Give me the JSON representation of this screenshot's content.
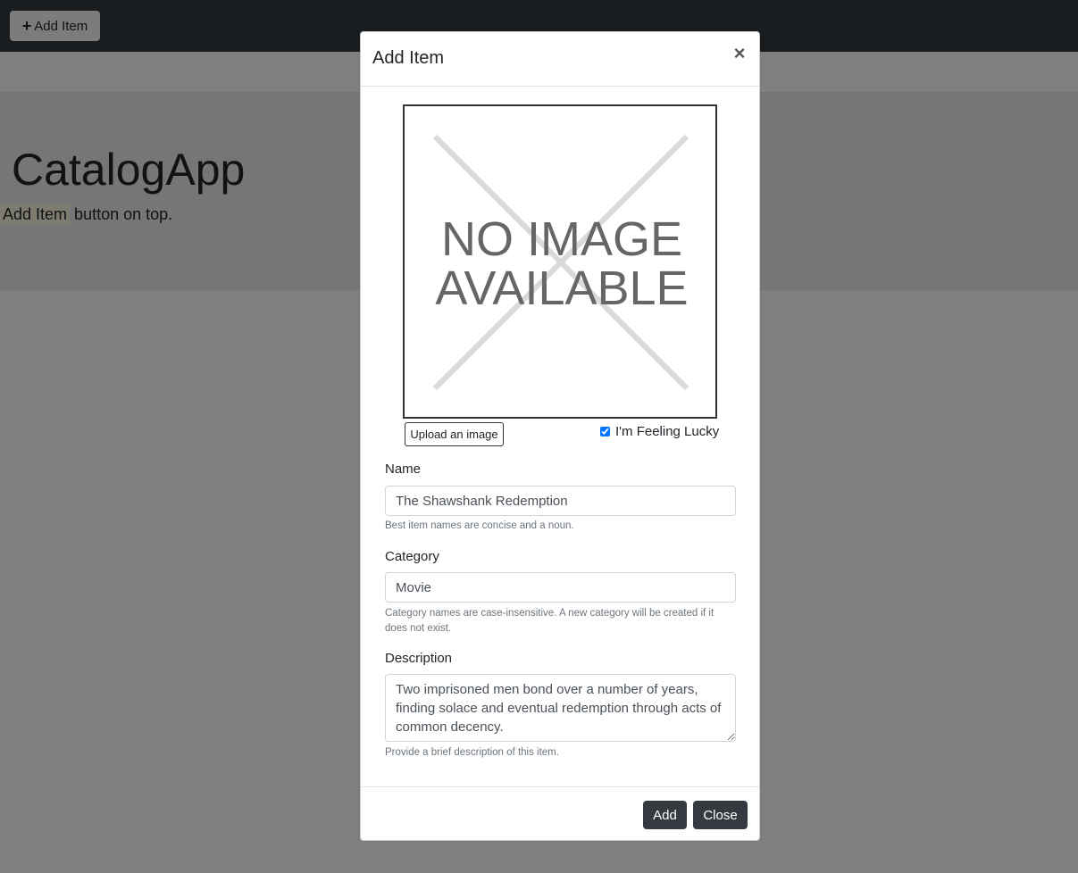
{
  "navbar": {
    "add_item_label": "Add Item"
  },
  "page": {
    "title": "CatalogApp",
    "hint_highlight": "Add Item",
    "hint_rest": " button on top."
  },
  "modal": {
    "title": "Add Item",
    "close_symbol": "×",
    "image_placeholder_line1": "NO IMAGE",
    "image_placeholder_line2": "AVAILABLE",
    "upload_label": "Upload an image",
    "lucky_label": "I'm Feeling Lucky",
    "lucky_checked": true,
    "name": {
      "label": "Name",
      "value": "The Shawshank Redemption",
      "help": "Best item names are concise and a noun."
    },
    "category": {
      "label": "Category",
      "value": "Movie",
      "help": "Category names are case-insensitive. A new category will be created if it does not exist."
    },
    "description": {
      "label": "Description",
      "value": "Two imprisoned men bond over a number of years, finding solace and eventual redemption through acts of common decency.",
      "help": "Provide a brief description of this item."
    },
    "add_label": "Add",
    "close_label": "Close"
  },
  "colors": {
    "navbar_bg": "#343a40",
    "jumbotron_bg": "#e9ecef",
    "dark_button": "#343a40",
    "backdrop": "rgba(0,0,0,0.5)"
  }
}
